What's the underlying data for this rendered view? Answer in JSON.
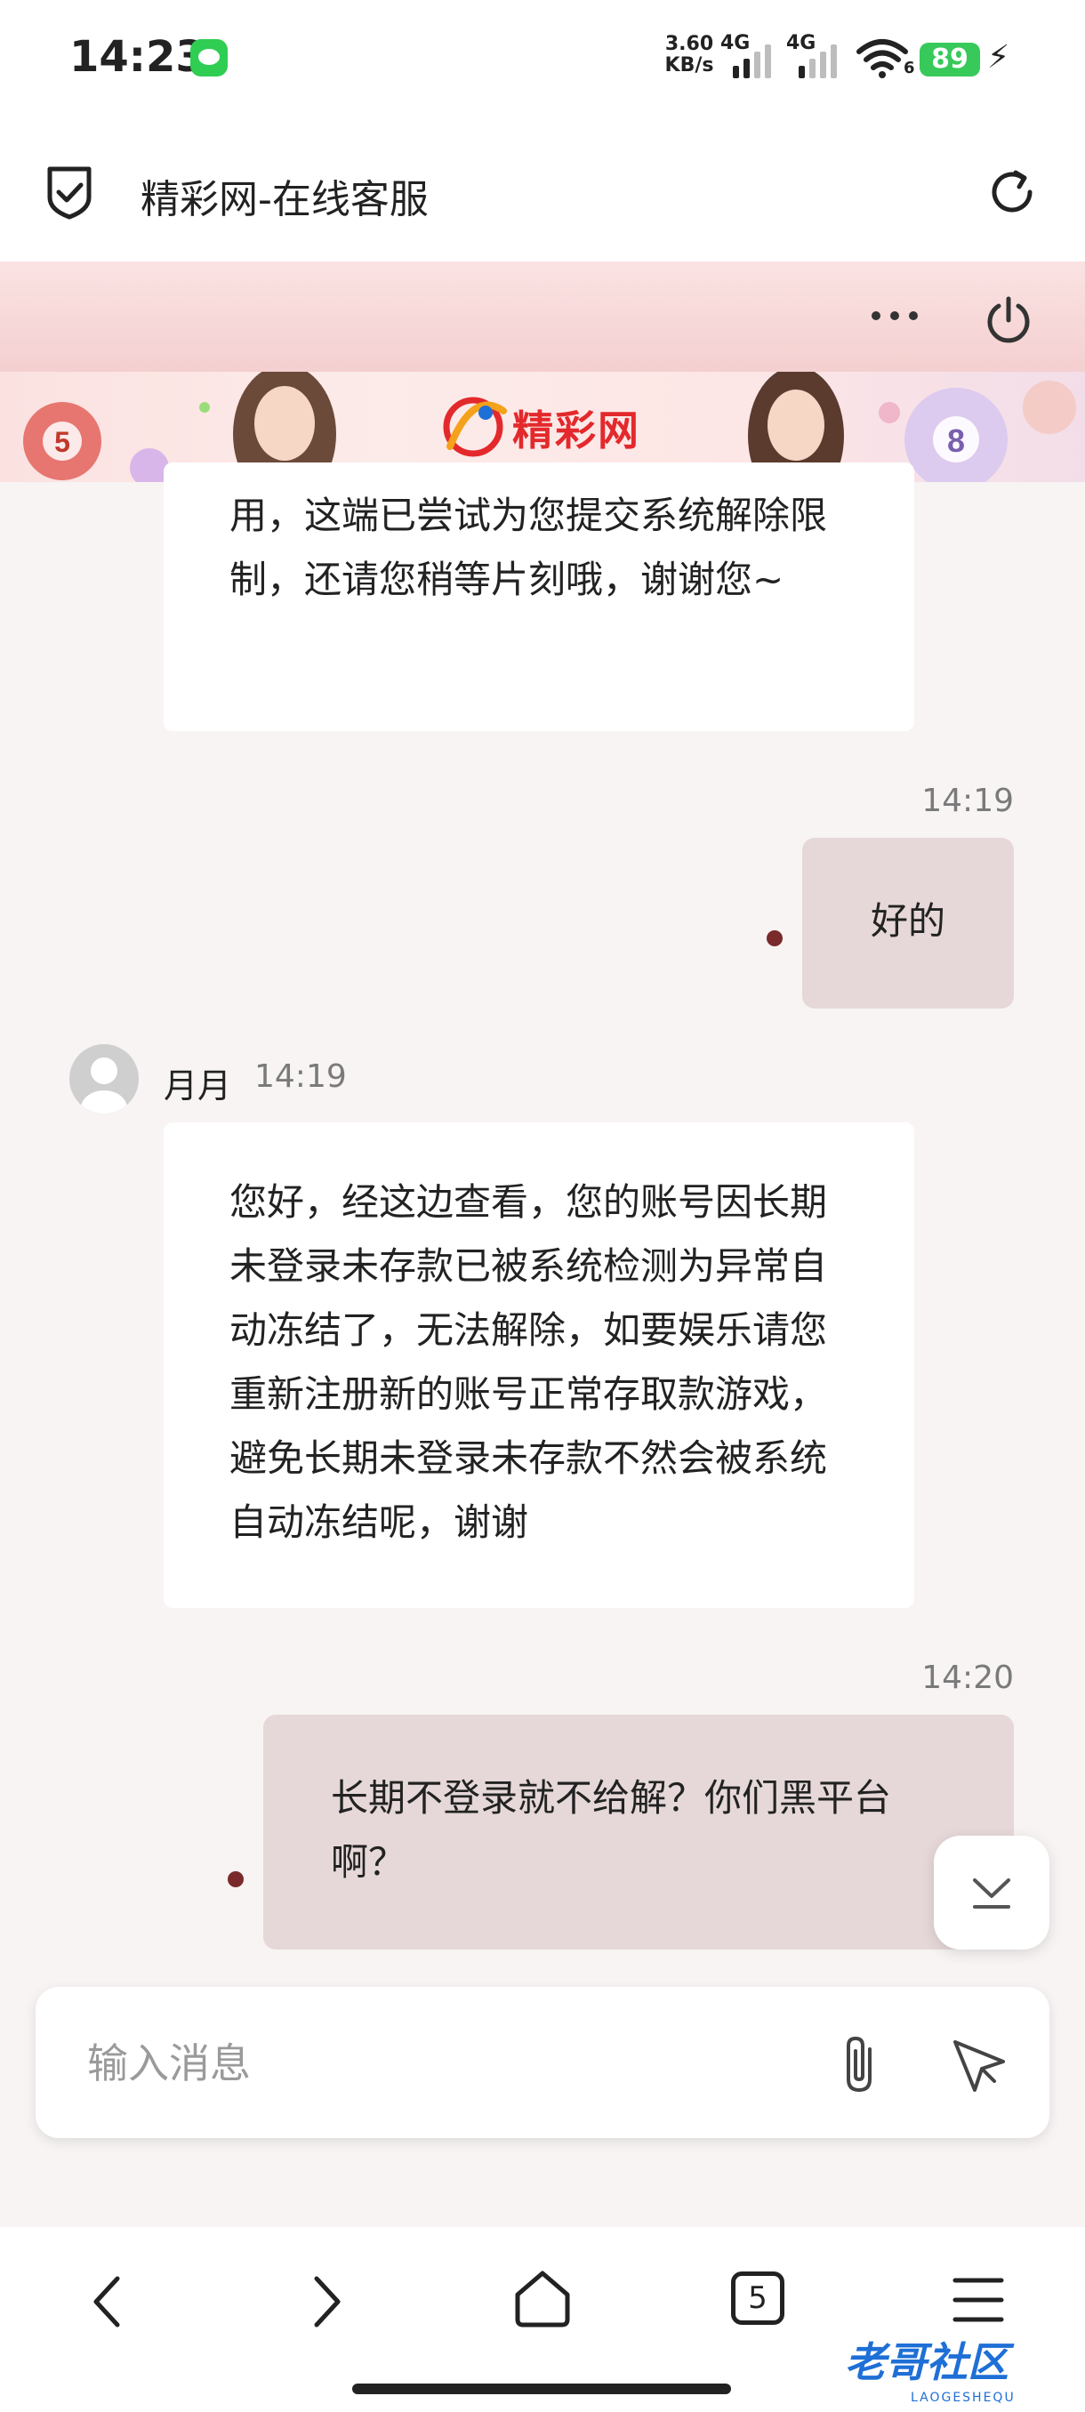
{
  "status_bar": {
    "time": "14:23",
    "net_speed_value": "3.60",
    "net_speed_unit": "KB/s",
    "sim1_label": "4G",
    "sim2_label": "4G",
    "wifi_label": "6",
    "battery": "89"
  },
  "browser": {
    "page_title": "精彩网-在线客服"
  },
  "banner": {
    "brand": "精彩网"
  },
  "chat": {
    "messages": [
      {
        "side": "agent",
        "text": "用，这端已尝试为您提交系统解除限制，还请您稍等片刻哦，谢谢您~"
      },
      {
        "side": "user",
        "time": "14:19",
        "text": "好的"
      },
      {
        "side": "agent",
        "name": "月月",
        "time": "14:19",
        "text": "您好，经这边查看，您的账号因长期未登录未存款已被系统检测为异常自动冻结了，无法解除，如要娱乐请您重新注册新的账号正常存取款游戏，避免长期未登录未存款不然会被系统自动冻结呢，谢谢"
      },
      {
        "side": "user",
        "time": "14:20",
        "text": "长期不登录就不给解？你们黑平台啊？"
      }
    ]
  },
  "input": {
    "placeholder": "输入消息"
  },
  "bottom_nav": {
    "tabs_count": "5"
  },
  "watermark": {
    "text": "老哥社区",
    "sub": "LAOGESHEQU"
  },
  "colors": {
    "accent": "#7a2a2a",
    "user_bubble": "#e6d8d8",
    "header_pink": "#f4cfd0",
    "brand_red": "#e3292c"
  }
}
